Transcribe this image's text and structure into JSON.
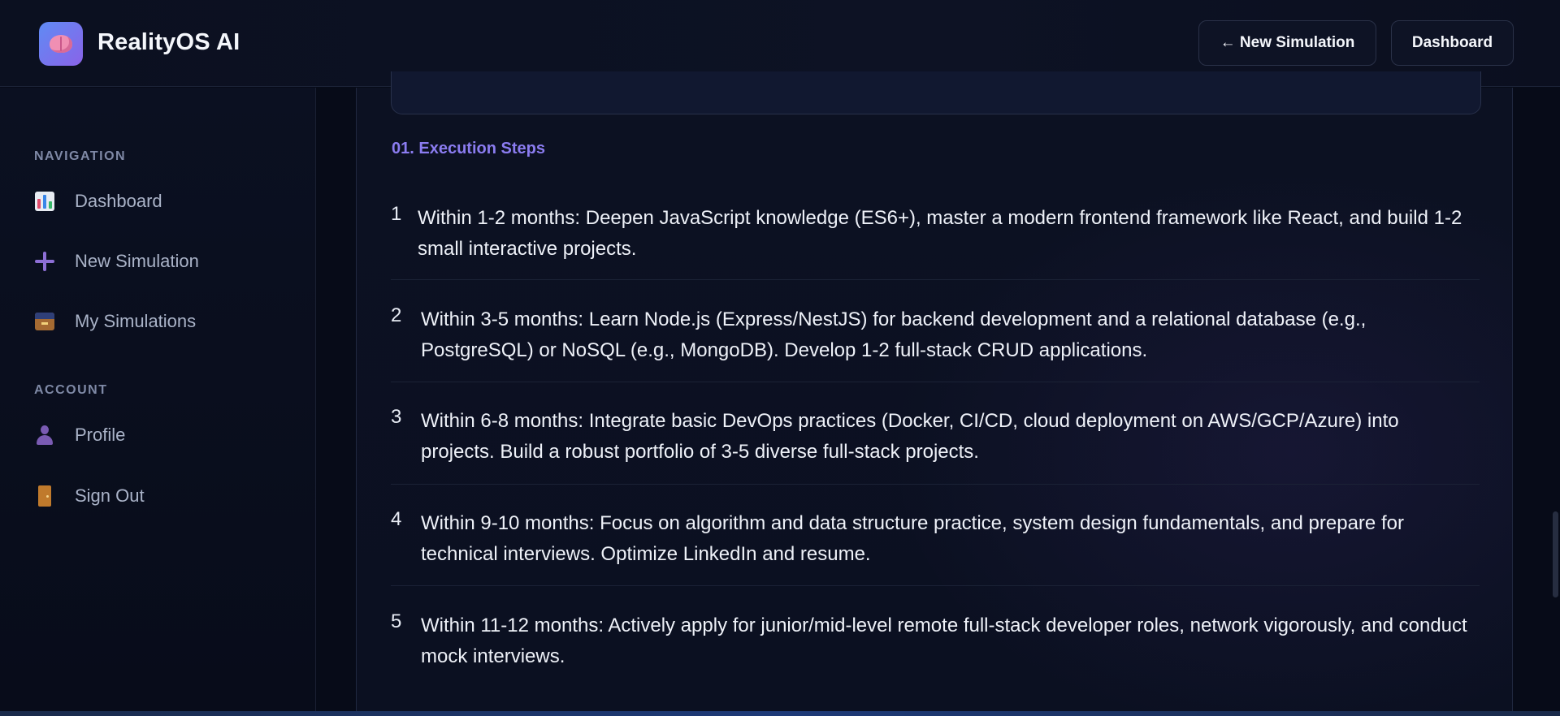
{
  "header": {
    "brand": "RealityOS AI",
    "new_simulation_label": "← New Simulation",
    "dashboard_label": "Dashboard"
  },
  "sidebar": {
    "navigation_title": "NAVIGATION",
    "account_title": "ACCOUNT",
    "nav_items": [
      {
        "label": "Dashboard",
        "icon": "bar-chart-icon"
      },
      {
        "label": "New Simulation",
        "icon": "plus-icon"
      },
      {
        "label": "My Simulations",
        "icon": "card-box-icon"
      }
    ],
    "account_items": [
      {
        "label": "Profile",
        "icon": "user-icon"
      },
      {
        "label": "Sign Out",
        "icon": "door-icon"
      }
    ]
  },
  "main": {
    "steps_heading": "01. Execution Steps",
    "steps": [
      {
        "num": "1",
        "text": "Within 1-2 months: Deepen JavaScript knowledge (ES6+), master a modern frontend framework like React, and build 1-2 small interactive projects."
      },
      {
        "num": "2",
        "text": "Within 3-5 months: Learn Node.js (Express/NestJS) for backend development and a relational database (e.g., PostgreSQL) or NoSQL (e.g., MongoDB). Develop 1-2 full-stack CRUD applications."
      },
      {
        "num": "3",
        "text": "Within 6-8 months: Integrate basic DevOps practices (Docker, CI/CD, cloud deployment on AWS/GCP/Azure) into projects. Build a robust portfolio of 3-5 diverse full-stack projects."
      },
      {
        "num": "4",
        "text": "Within 9-10 months: Focus on algorithm and data structure practice, system design fundamentals, and prepare for technical interviews. Optimize LinkedIn and resume."
      },
      {
        "num": "5",
        "text": "Within 11-12 months: Actively apply for junior/mid-level remote full-stack developer roles, network vigorously, and conduct mock interviews."
      }
    ]
  },
  "colors": {
    "accent": "#8b7cf0",
    "background": "#070b18",
    "logo_gradient_start": "#5f8bf4",
    "logo_gradient_end": "#8a63e8"
  }
}
